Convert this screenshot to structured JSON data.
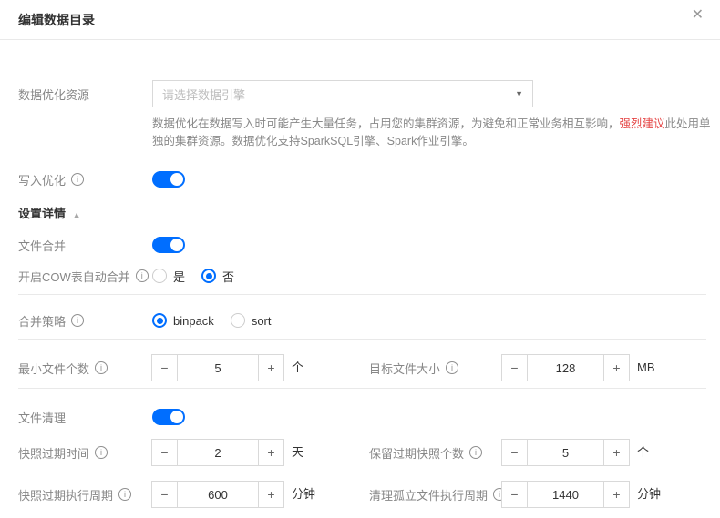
{
  "colors": {
    "accent": "#006eff",
    "danger": "#e54545"
  },
  "glyphs": {
    "minus": "−",
    "plus": "+",
    "info": "i",
    "collapse": "▲",
    "dropdown": "▼",
    "close": "✕"
  },
  "header": {
    "title": "编辑数据目录"
  },
  "resource": {
    "label": "数据优化资源",
    "placeholder": "请选择数据引擎",
    "help": {
      "pre": "数据优化在数据写入时可能产生大量任务，占用您的集群资源，为避免和正常业务相互影响，",
      "highlight": "强烈建议",
      "post": "此处用单独的集群资源。数据优化支持SparkSQL引擎、Spark作业引擎。"
    }
  },
  "write_optimize": {
    "label": "写入优化",
    "enabled": true
  },
  "details": {
    "label": "设置详情"
  },
  "file_merge": {
    "label": "文件合并",
    "enabled": true
  },
  "cow_merge": {
    "label": "开启COW表自动合并",
    "options": [
      {
        "label": "是",
        "selected": false
      },
      {
        "label": "否",
        "selected": true
      }
    ]
  },
  "merge_strategy": {
    "label": "合并策略",
    "options": [
      {
        "label": "binpack",
        "selected": true
      },
      {
        "label": "sort",
        "selected": false
      }
    ]
  },
  "min_files": {
    "label": "最小文件个数",
    "value": "5",
    "unit": "个"
  },
  "target_size": {
    "label": "目标文件大小",
    "value": "128",
    "unit": "MB"
  },
  "file_clean": {
    "label": "文件清理",
    "enabled": true
  },
  "snapshot_expire": {
    "label": "快照过期时间",
    "value": "2",
    "unit": "天"
  },
  "snapshot_keep": {
    "label": "保留过期快照个数",
    "value": "5",
    "unit": "个"
  },
  "snapshot_cycle": {
    "label": "快照过期执行周期",
    "value": "600",
    "unit": "分钟"
  },
  "orphan_cycle": {
    "label": "清理孤立文件执行周期",
    "value": "1440",
    "unit": "分钟"
  }
}
